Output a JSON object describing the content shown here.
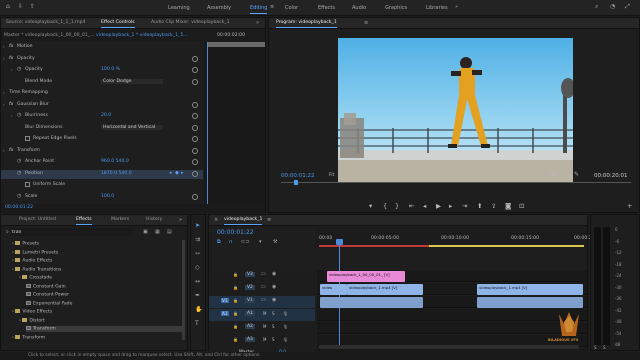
{
  "workspaces": [
    "Learning",
    "Assembly",
    "Editing",
    "Color",
    "Effects",
    "Audio",
    "Graphics",
    "Libraries"
  ],
  "active_workspace": "Editing",
  "source_panel": {
    "tabs": [
      "Source: videoplayback_1_1_1.mp4",
      "Effect Controls",
      "Audio Clip Mixer: videoplayback_1"
    ],
    "master_label": "Master * videoplayback_1_00_00_01_...",
    "clip_label": "videoplayback_1 * videoplayback_1_5...",
    "timecode_ruler": "00:00:02:00",
    "footer_timecode": "00:00:01:22",
    "rows": [
      {
        "label": "Motion",
        "value": ""
      },
      {
        "label": "Opacity",
        "value": ""
      },
      {
        "label": "Opacity",
        "value": "100.0 %"
      },
      {
        "label": "Blend Mode",
        "value": "Color Dodge"
      },
      {
        "label": "Time Remapping",
        "value": ""
      },
      {
        "label": "Gaussian Blur",
        "value": ""
      },
      {
        "label": "Blurriness",
        "value": "20.0"
      },
      {
        "label": "Blur Dimensions",
        "value": "Horizontal and Vertical"
      },
      {
        "label": "Repeat Edge Pixels",
        "value": ""
      },
      {
        "label": "Transform",
        "value": ""
      },
      {
        "label": "Anchor Point",
        "value": "960.0    540.0"
      },
      {
        "label": "Position",
        "value": "1870.0    540.0"
      },
      {
        "label": "Uniform Scale",
        "value": ""
      },
      {
        "label": "Scale",
        "value": "100.0"
      }
    ]
  },
  "program_panel": {
    "title": "Program: videoplayback_1",
    "timecode": "00:00:01:22",
    "fit": "Fit",
    "ratio": "1/2",
    "duration": "00:00:20:01"
  },
  "project_panel": {
    "tabs": [
      "Project: Untitled",
      "Effects",
      "Markers",
      "History"
    ],
    "search_value": "tran",
    "tree": [
      {
        "label": "Presets",
        "indent": 1,
        "type": "folder"
      },
      {
        "label": "Lumetri Presets",
        "indent": 1,
        "type": "folder"
      },
      {
        "label": "Audio Effects",
        "indent": 1,
        "type": "folder"
      },
      {
        "label": "Audio Transitions",
        "indent": 1,
        "type": "folder"
      },
      {
        "label": "Crossfade",
        "indent": 2,
        "type": "folder"
      },
      {
        "label": "Constant Gain",
        "indent": 3,
        "type": "fx"
      },
      {
        "label": "Constant Power",
        "indent": 3,
        "type": "fx"
      },
      {
        "label": "Exponential Fade",
        "indent": 3,
        "type": "fx"
      },
      {
        "label": "Video Effects",
        "indent": 1,
        "type": "folder"
      },
      {
        "label": "Distort",
        "indent": 2,
        "type": "folder"
      },
      {
        "label": "Transform",
        "indent": 3,
        "type": "fx"
      },
      {
        "label": "Transform",
        "indent": 1,
        "type": "folder"
      }
    ]
  },
  "timeline": {
    "tab": "videoplayback_1",
    "timecode": "00:00:01:22",
    "ruler": [
      "00:00",
      "00:00:05:00",
      "00:00:10:00",
      "00:00:15:00",
      "00:00:20:00"
    ],
    "tracks": [
      "V3",
      "V2",
      "V1",
      "A1",
      "A2",
      "A3",
      "Master"
    ],
    "master_value": "0.0",
    "clips": {
      "v3": "videoplayback_1_00_00_01_ [V]",
      "v2a": "video",
      "v2b": "videoplayback_1.mp4 [V]",
      "v2c": "videoplayback_1.mp4 [V]"
    },
    "watermark": "BILADIOUS VFX"
  },
  "meter_labels": [
    "0",
    "-6",
    "-12",
    "-18",
    "-24",
    "-30",
    "-36",
    "-42",
    "-48",
    "-54",
    "dB"
  ],
  "status_text": "Click to select, or click in empty space and drag to marquee select. Use Shift, Alt, and Ctrl for other options.",
  "colors": {
    "accent": "#5aa6ff",
    "clip_pink": "#e88ad7",
    "clip_blue": "#8fb4e8",
    "sky": "#66bce5"
  }
}
